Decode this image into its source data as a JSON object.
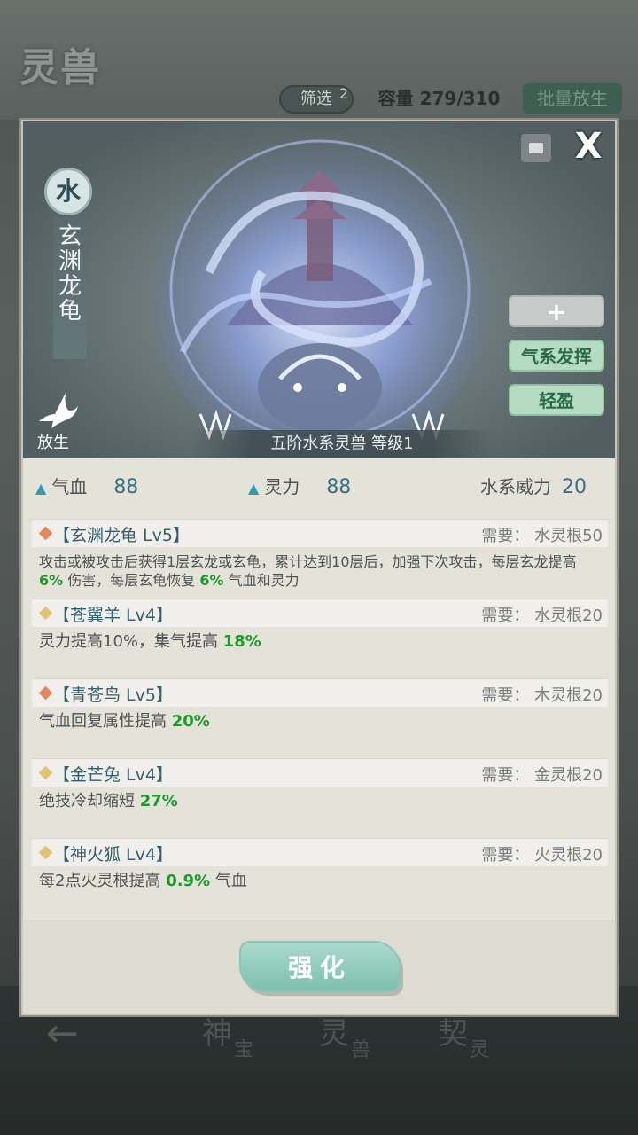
{
  "background": {
    "title": "灵兽",
    "filter_label": "筛选",
    "filter_count": "2",
    "capacity": "容量 279/310",
    "batch_release": "批量放生",
    "nav": [
      {
        "main": "神",
        "sub": "宝"
      },
      {
        "main": "灵",
        "sub": "兽"
      },
      {
        "main": "契",
        "sub": "灵"
      }
    ],
    "back_icon": "←"
  },
  "beast": {
    "element": "水",
    "name_chars": [
      "玄",
      "渊",
      "龙",
      "龟"
    ],
    "release_label": "放生",
    "rank_text": "五阶水系灵兽   等级1",
    "close_icon": "X",
    "buttons": {
      "plus": "+",
      "qi": "气系发挥",
      "light": "轻盈"
    }
  },
  "stats": {
    "hp_label": "气血",
    "hp_value": "88",
    "spirit_label": "灵力",
    "spirit_value": "88",
    "power_label": "水系威力",
    "power_value": "20"
  },
  "skills": [
    {
      "name": "【玄渊龙龟 Lv5】",
      "req": "需要： 水灵根50",
      "diamond_color": "#e8855a",
      "desc_parts": [
        "攻击或被攻击后获得1层玄龙或玄龟，累计达到10层后，加强下次攻击，每层玄龙提高 ",
        "6%",
        " 伤害，每层玄龟恢复 ",
        "6%",
        " 气血和灵力"
      ]
    },
    {
      "name": "【苍翼羊 Lv4】",
      "req": "需要： 水灵根20",
      "diamond_color": "#e2c46e",
      "desc_parts": [
        "灵力提高10%，集气提高 ",
        "18%"
      ]
    },
    {
      "name": "【青苍鸟 Lv5】",
      "req": "需要： 木灵根20",
      "diamond_color": "#e8855a",
      "desc_parts": [
        "气血回复属性提高 ",
        "20%"
      ]
    },
    {
      "name": "【金芒兔 Lv4】",
      "req": "需要： 金灵根20",
      "diamond_color": "#e2c46e",
      "desc_parts": [
        "绝技冷却缩短 ",
        "27%"
      ]
    },
    {
      "name": "【神火狐 Lv4】",
      "req": "需要： 火灵根20",
      "diamond_color": "#e2c46e",
      "desc_parts": [
        "每2点火灵根提高 ",
        "0.9%",
        " 气血"
      ]
    }
  ],
  "enhance_label": "强化",
  "icons": {
    "lock": "lock-icon",
    "bird": "dove-icon",
    "triangle": "up-triangle-icon",
    "diamond": "diamond-icon"
  }
}
